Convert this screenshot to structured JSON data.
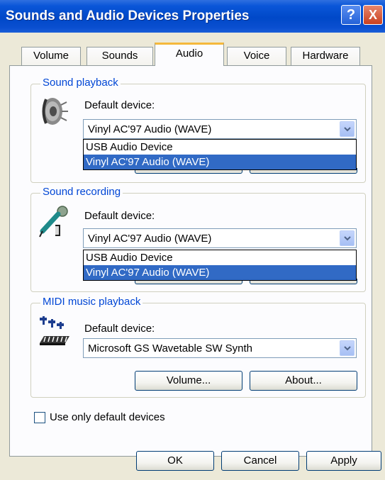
{
  "window": {
    "title": "Sounds and Audio Devices Properties"
  },
  "titlebar_buttons": {
    "help": "?",
    "close": "X"
  },
  "tabs": [
    {
      "label": "Volume",
      "active": false
    },
    {
      "label": "Sounds",
      "active": false
    },
    {
      "label": "Audio",
      "active": true
    },
    {
      "label": "Voice",
      "active": false
    },
    {
      "label": "Hardware",
      "active": false
    }
  ],
  "sound_playback": {
    "legend": "Sound playback",
    "label": "Default device:",
    "value": "Vinyl AC'97 Audio (WAVE)",
    "options": [
      "USB Audio Device",
      "Vinyl AC'97 Audio (WAVE)"
    ],
    "selected_option": 1
  },
  "sound_recording": {
    "legend": "Sound recording",
    "label": "Default device:",
    "value": "Vinyl AC'97 Audio (WAVE)",
    "options": [
      "USB Audio Device",
      "Vinyl AC'97 Audio (WAVE)"
    ],
    "selected_option": 1
  },
  "midi_playback": {
    "legend": "MIDI music playback",
    "label": "Default device:",
    "value": "Microsoft GS Wavetable SW Synth",
    "volume_button": "Volume...",
    "about_button": "About..."
  },
  "use_default_devices": {
    "label": "Use only default devices",
    "checked": false
  },
  "footer": {
    "ok": "OK",
    "cancel": "Cancel",
    "apply": "Apply"
  },
  "icons": [
    "speaker-icon",
    "microphone-icon",
    "midi-keyboard-icon",
    "chevron-down-icon",
    "help-icon",
    "close-icon"
  ],
  "colors": {
    "titlebar": "#0048c8",
    "selection": "#316ac5",
    "group_legend": "#0046d5",
    "dialog_bg": "#ece9d8",
    "active_tab_accent": "#f5b83b"
  }
}
